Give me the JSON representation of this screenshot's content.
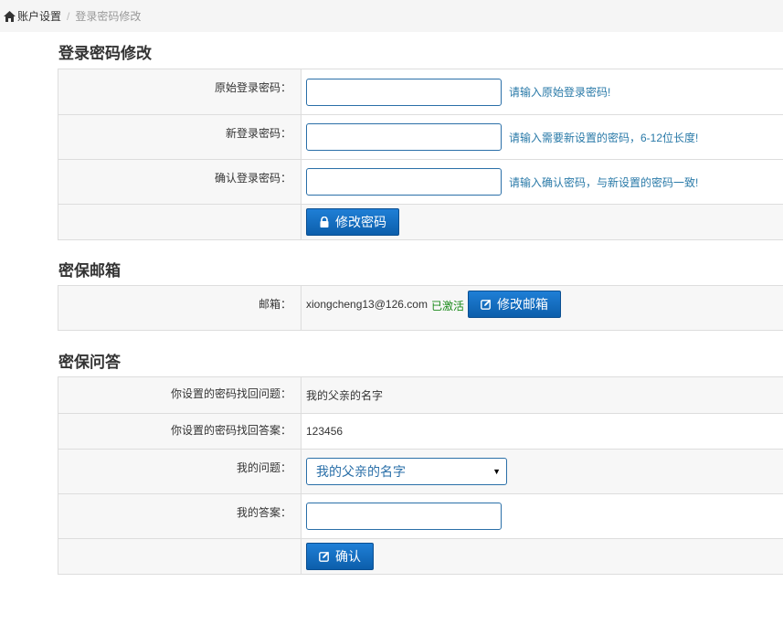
{
  "breadcrumb": {
    "home": "账户设置",
    "current": "登录密码修改"
  },
  "password_section": {
    "title": "登录密码修改",
    "fields": [
      {
        "label": "原始登录密码：",
        "hint": "请输入原始登录密码!"
      },
      {
        "label": "新登录密码：",
        "hint": "请输入需要新设置的密码，6-12位长度!"
      },
      {
        "label": "确认登录密码：",
        "hint": "请输入确认密码，与新设置的密码一致!"
      }
    ],
    "submit_label": "修改密码"
  },
  "email_section": {
    "title": "密保邮箱",
    "label": "邮箱：",
    "email": "xiongcheng13@126.com",
    "status": "已激活",
    "button_label": "修改邮箱"
  },
  "question_section": {
    "title": "密保问答",
    "current_question_label": "你设置的密码找回问题：",
    "current_question": "我的父亲的名字",
    "current_answer_label": "你设置的密码找回答案：",
    "current_answer": "123456",
    "my_question_label": "我的问题：",
    "my_question_selected": "我的父亲的名字",
    "my_answer_label": "我的答案：",
    "submit_label": "确认"
  },
  "colors": {
    "button": "#1570c4",
    "hint": "#2a7aa8",
    "active": "#1a8a1a"
  }
}
